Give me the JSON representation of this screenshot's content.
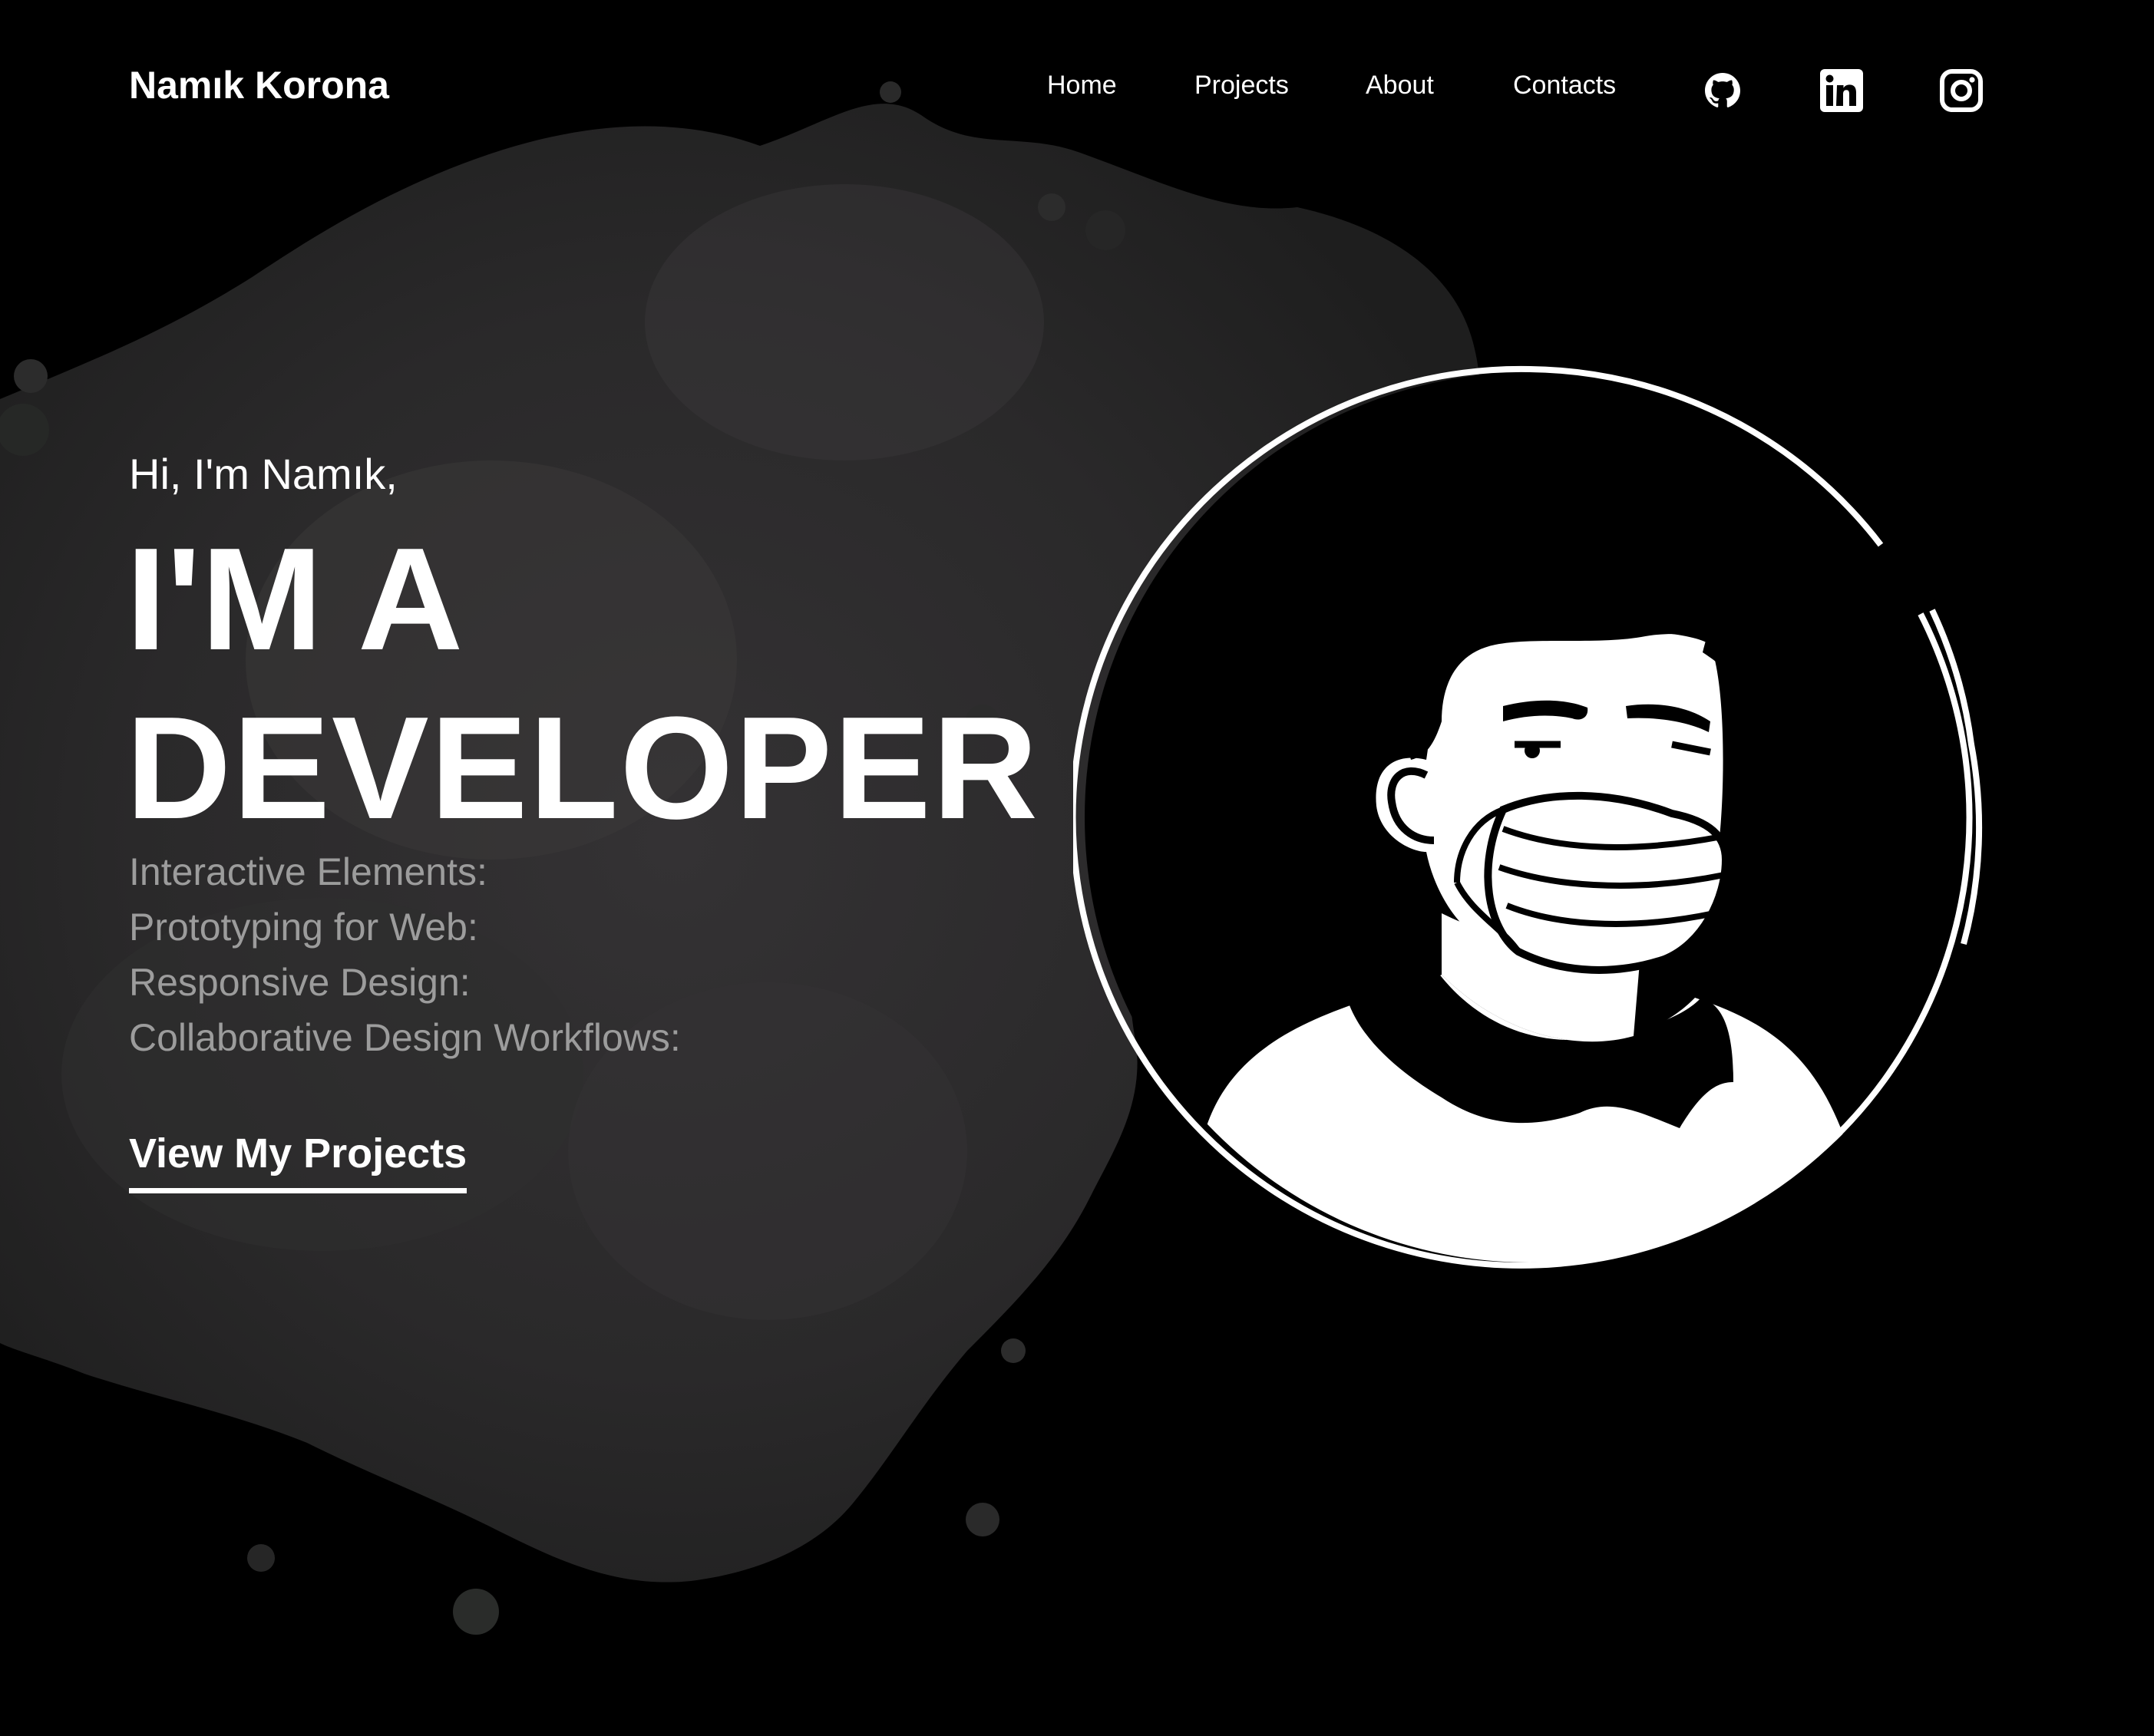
{
  "header": {
    "logo": "Namık Korona",
    "nav": [
      {
        "label": "Home"
      },
      {
        "label": "Projects"
      },
      {
        "label": "About"
      },
      {
        "label": "Contacts"
      }
    ],
    "social": [
      {
        "icon": "github-icon"
      },
      {
        "icon": "linkedin-icon"
      },
      {
        "icon": "instagram-icon"
      }
    ]
  },
  "hero": {
    "greeting": "Hi, I'm Namık,",
    "headline_line1": "I'M A",
    "headline_line2": "DEVELOPER",
    "skills": [
      "Interactive Elements:",
      "Prototyping for Web:",
      "Responsive Design:",
      "Collaborative Design Workflows:"
    ],
    "cta": "View My Projects"
  },
  "colors": {
    "background": "#000000",
    "text": "#ffffff",
    "muted": "#9c9c9c",
    "splash": "#2a2a2a"
  }
}
